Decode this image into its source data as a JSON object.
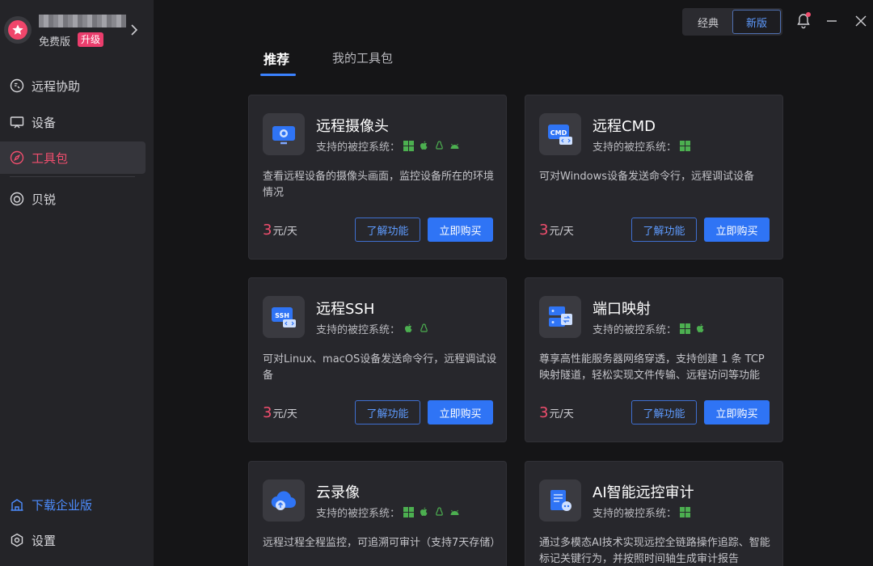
{
  "profile": {
    "plan": "免费版",
    "upgrade": "升级"
  },
  "sidebar": {
    "items": [
      {
        "label": "远程协助",
        "icon": "remote-assist-icon"
      },
      {
        "label": "设备",
        "icon": "device-icon"
      },
      {
        "label": "工具包",
        "icon": "compass-icon"
      },
      {
        "label": "贝锐",
        "icon": "oray-icon"
      }
    ],
    "enterprise": "下载企业版",
    "settings": "设置"
  },
  "header": {
    "classic": "经典",
    "new": "新版"
  },
  "tabs": [
    {
      "label": "推荐"
    },
    {
      "label": "我的工具包"
    }
  ],
  "cards": [
    {
      "title": "远程摄像头",
      "os_label": "支持的被控系统：",
      "os": [
        "windows",
        "mac",
        "linux",
        "android"
      ],
      "desc": "查看远程设备的摄像头画面，监控设备所在的环境情况",
      "price_num": "3",
      "price_unit": "元/天",
      "learn": "了解功能",
      "buy": "立即购买"
    },
    {
      "title": "远程CMD",
      "os_label": "支持的被控系统：",
      "os": [
        "windows"
      ],
      "desc": "可对Windows设备发送命令行，远程调试设备",
      "price_num": "3",
      "price_unit": "元/天",
      "learn": "了解功能",
      "buy": "立即购买"
    },
    {
      "title": "远程SSH",
      "os_label": "支持的被控系统：",
      "os": [
        "mac",
        "linux"
      ],
      "desc": "可对Linux、macOS设备发送命令行，远程调试设备",
      "price_num": "3",
      "price_unit": "元/天",
      "learn": "了解功能",
      "buy": "立即购买"
    },
    {
      "title": "端口映射",
      "os_label": "支持的被控系统：",
      "os": [
        "windows",
        "mac"
      ],
      "desc": "尊享高性能服务器网络穿透，支持创建 1 条 TCP 映射隧道，轻松实现文件传输、远程访问等功能",
      "price_num": "3",
      "price_unit": "元/天",
      "learn": "了解功能",
      "buy": "立即购买"
    },
    {
      "title": "云录像",
      "os_label": "支持的被控系统：",
      "os": [
        "windows",
        "mac",
        "linux",
        "android"
      ],
      "desc": "远程过程全程监控，可追溯可审计（支持7天存储）"
    },
    {
      "title": "AI智能远控审计",
      "os_label": "支持的被控系统：",
      "os": [
        "windows"
      ],
      "desc": "通过多模态AI技术实现远控全链路操作追踪、智能标记关键行为，并按照时间轴生成审计报告"
    }
  ],
  "colors": {
    "accent": "#2f74f5",
    "active": "#f14e6e",
    "sidebar": "#242428",
    "card": "#27272c"
  }
}
